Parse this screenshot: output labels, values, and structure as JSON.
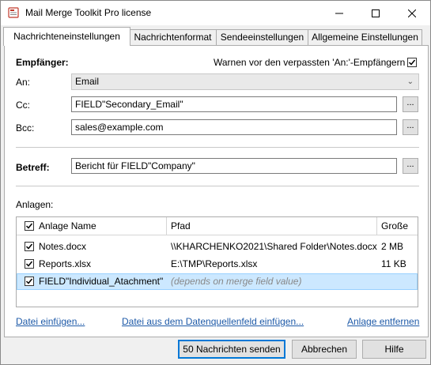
{
  "window": {
    "title": "Mail Merge Toolkit Pro license"
  },
  "tabs": [
    {
      "label": "Nachrichteneinstellungen"
    },
    {
      "label": "Nachrichtenformat"
    },
    {
      "label": "Sendeeinstellungen"
    },
    {
      "label": "Allgemeine Einstellungen"
    }
  ],
  "recipients": {
    "section_label": "Empfänger:",
    "warn_label": "Warnen vor den verpassten 'An:'-Empfängern",
    "warn_checked": true,
    "to_label": "An:",
    "to_value": "Email",
    "cc_label": "Cc:",
    "cc_value": "FIELD\"Secondary_Email\"",
    "bcc_label": "Bcc:",
    "bcc_value": "sales@example.com",
    "browse_label": "..."
  },
  "subject": {
    "label": "Betreff:",
    "value": "Bericht für FIELD\"Company\"",
    "browse_label": "..."
  },
  "attachments": {
    "section_label": "Anlagen:",
    "columns": [
      "Anlage Name",
      "Pfad",
      "Große"
    ],
    "rows": [
      {
        "name": "Notes.docx",
        "path": "\\\\KHARCHENKO2021\\Shared Folder\\Notes.docx",
        "size": "2 MB",
        "checked": true
      },
      {
        "name": "Reports.xlsx",
        "path": "E:\\TMP\\Reports.xlsx",
        "size": "11 KB",
        "checked": true
      },
      {
        "name": "FIELD\"Individual_Atachment\"",
        "path": "(depends on merge field value)",
        "size": "",
        "checked": true
      }
    ],
    "links": {
      "insert_file": "Datei einfügen...",
      "insert_from_field": "Datei aus dem Datenquellenfeld einfügen...",
      "remove": "Anlage entfernen"
    }
  },
  "buttons": {
    "send": "50 Nachrichten senden",
    "cancel": "Abbrechen",
    "help": "Hilfe"
  }
}
